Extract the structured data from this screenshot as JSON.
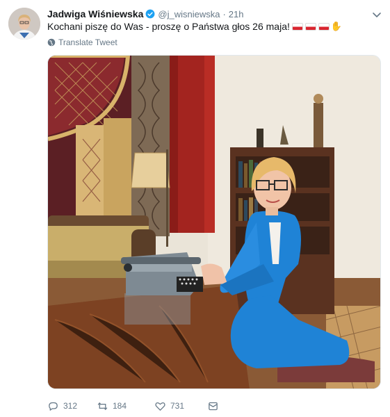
{
  "author": {
    "name": "Jadwiga Wiśniewska",
    "handle": "@j_wisniewska",
    "separator": "·",
    "time": "21h"
  },
  "tweet": {
    "text": "Kochani piszę do Was - proszę o Państwa głos 26 maja!",
    "emoji": [
      "poland-flag",
      "poland-flag",
      "poland-flag",
      "thumbs-up"
    ]
  },
  "translate": {
    "label": "Translate Tweet"
  },
  "actions": {
    "reply_count": "312",
    "retweet_count": "184",
    "like_count": "731"
  },
  "colors": {
    "text": "#14171a",
    "secondary": "#657786",
    "verified": "#1da1f2",
    "jacket": "#1f83d6"
  }
}
